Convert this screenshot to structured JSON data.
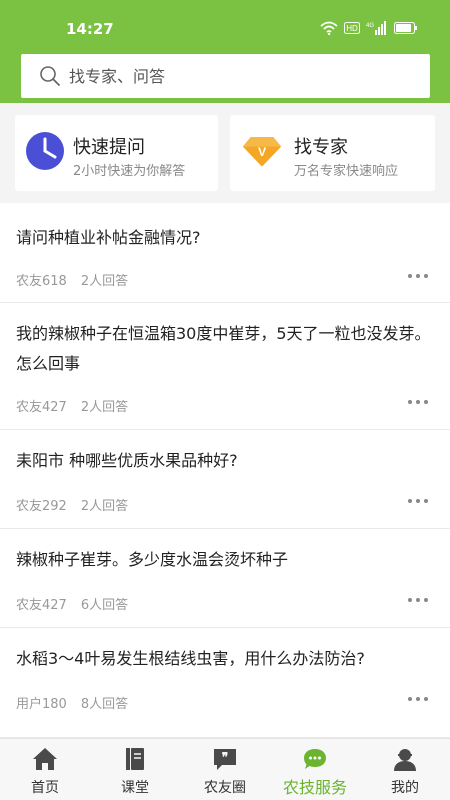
{
  "status": {
    "time": "14:27",
    "hd": "HD",
    "network": "4G"
  },
  "search": {
    "placeholder": "找专家、问答"
  },
  "quick": {
    "ask": {
      "title": "快速提问",
      "subtitle": "2小时快速为你解答"
    },
    "expert": {
      "title": "找专家",
      "subtitle": "万名专家快速响应",
      "badge": "V"
    }
  },
  "questions": [
    {
      "title": "请问种植业补帖金融情况?",
      "user": "农友618",
      "answers": "2人回答"
    },
    {
      "title": "我的辣椒种子在恒温箱30度中崔芽，5天了一粒也没发芽。怎么回事",
      "user": "农友427",
      "answers": "2人回答"
    },
    {
      "title": "耒阳市 种哪些优质水果品种好?",
      "user": "农友292",
      "answers": "2人回答"
    },
    {
      "title": "辣椒种子崔芽。多少度水温会烫坏种子",
      "user": "农友427",
      "answers": "6人回答"
    },
    {
      "title": "水稻3～4叶易发生根结线虫害，用什么办法防治?",
      "user": "用户180",
      "answers": "8人回答"
    }
  ],
  "tabs": [
    {
      "label": "首页",
      "icon": "home-icon"
    },
    {
      "label": "课堂",
      "icon": "book-icon"
    },
    {
      "label": "农友圈",
      "icon": "quote-bubble-icon"
    },
    {
      "label": "农技服务",
      "icon": "chat-bubble-icon",
      "active": true
    },
    {
      "label": "我的",
      "icon": "user-icon"
    }
  ],
  "colors": {
    "brand": "#7cc242",
    "active_tab": "#6ab42f",
    "clock_icon": "#4a4fd6",
    "diamond_icon": "#f5a623"
  }
}
